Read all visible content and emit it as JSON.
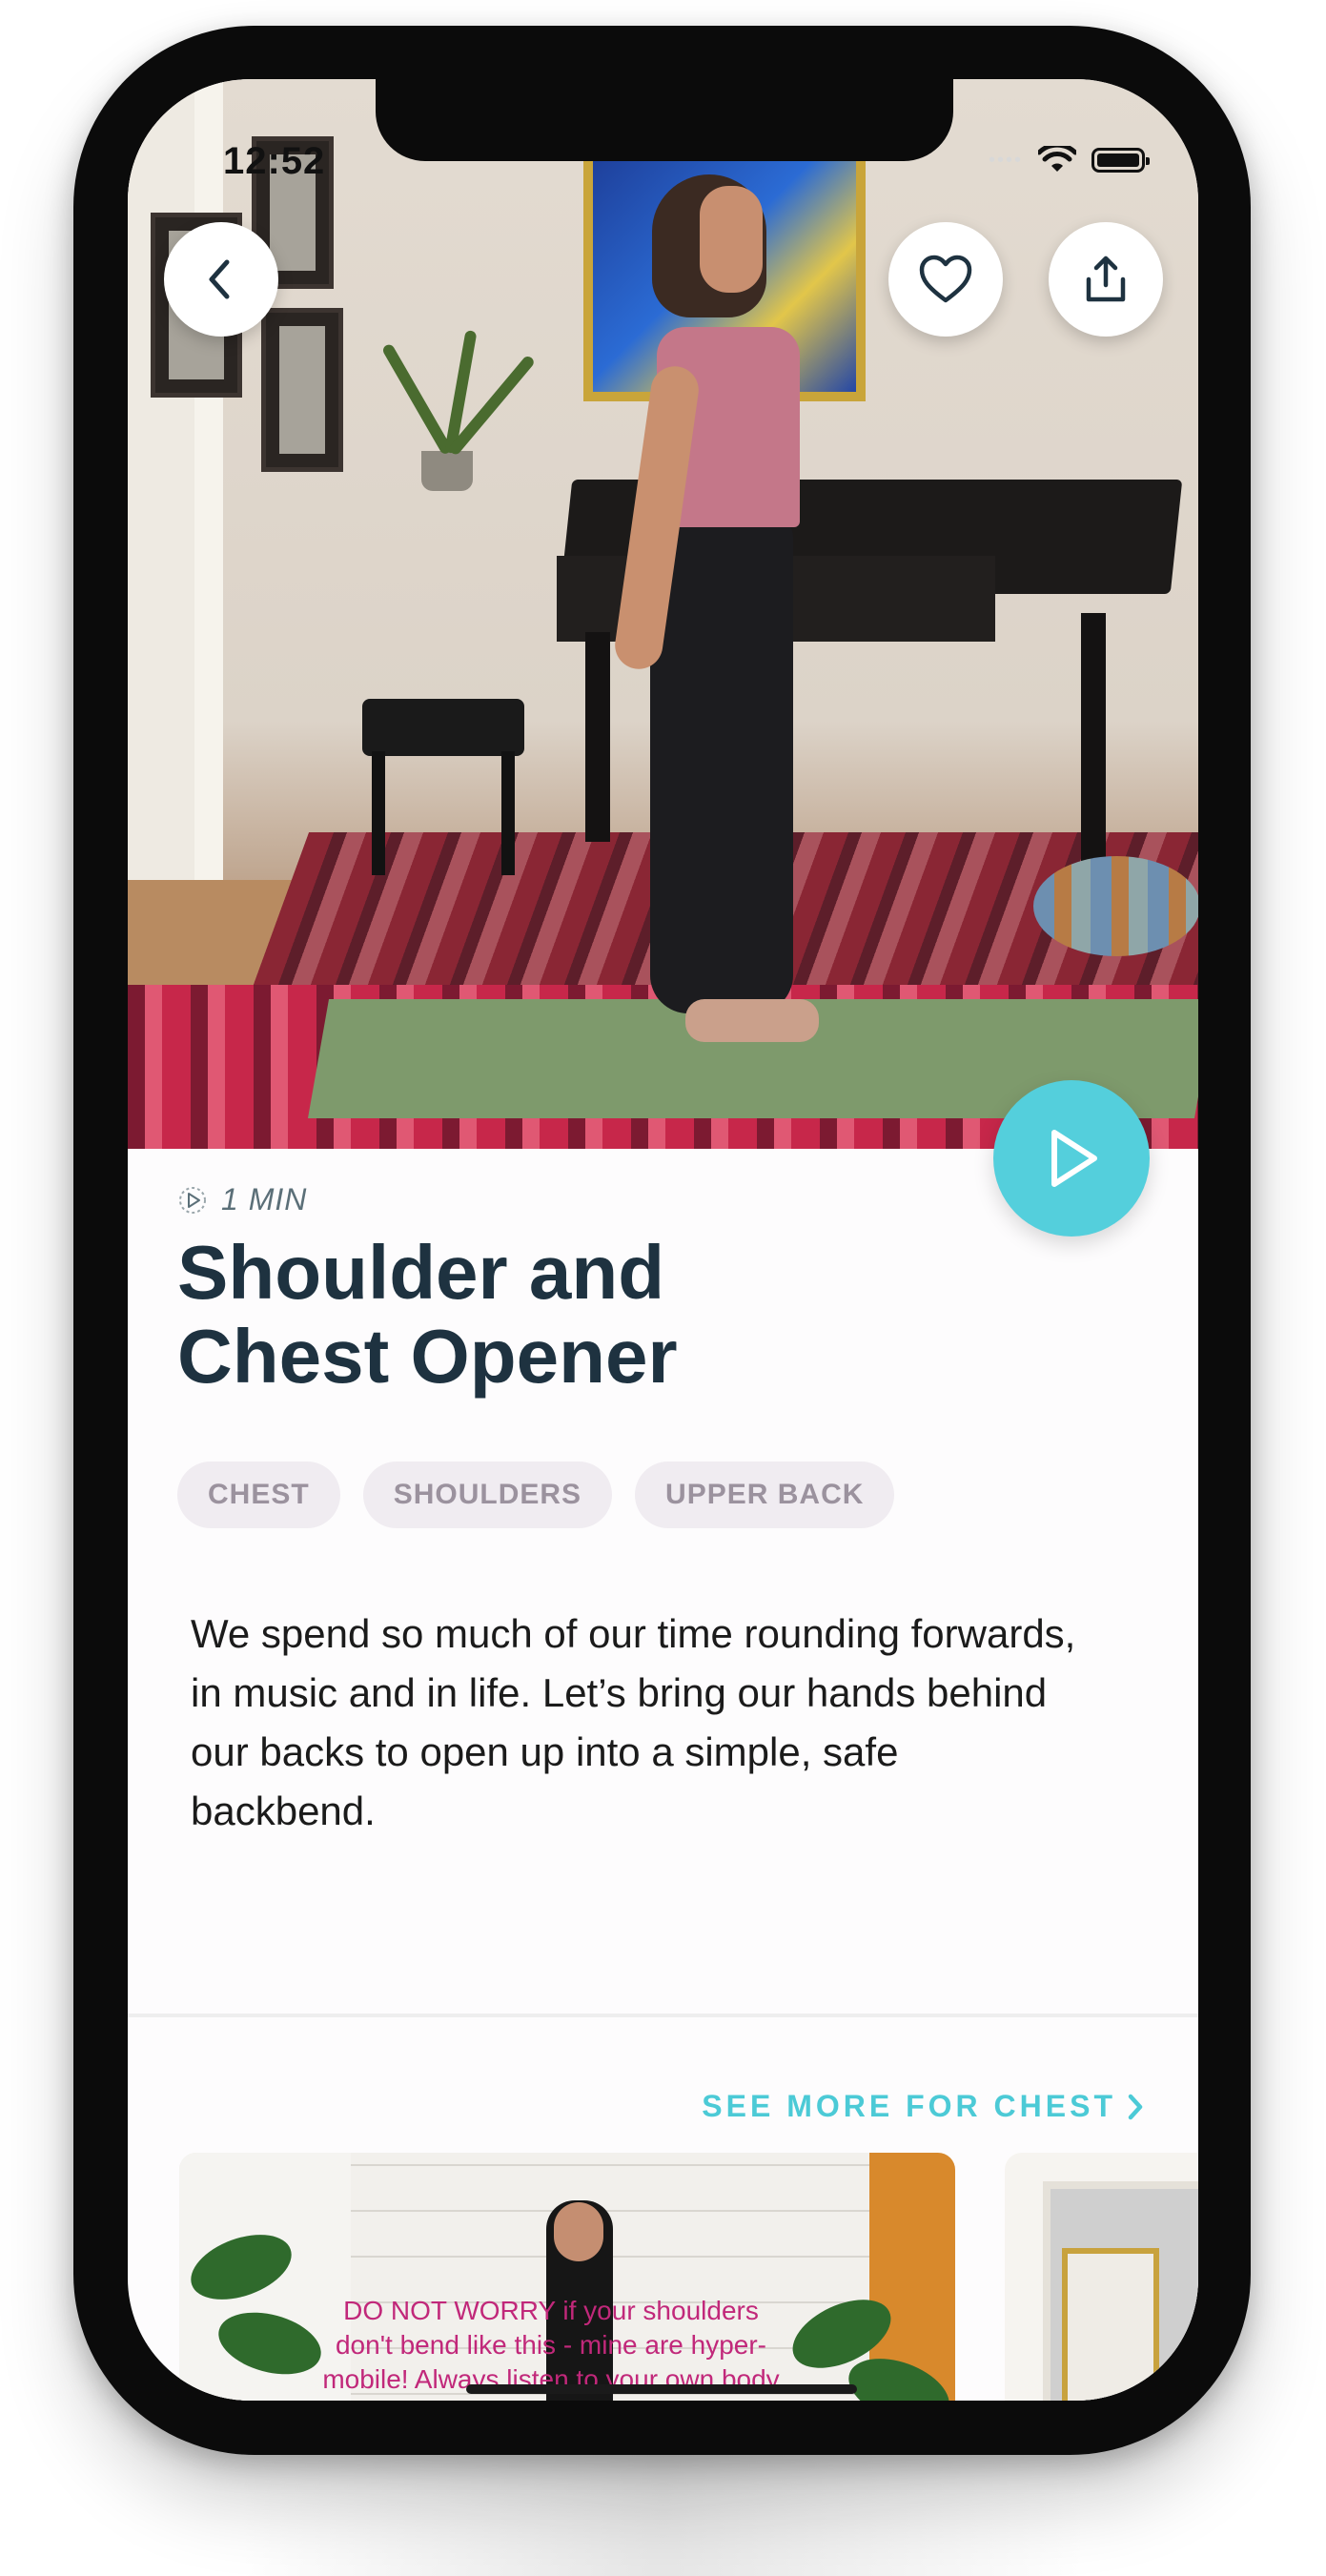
{
  "status_bar": {
    "time": "12:52"
  },
  "header_actions": {
    "back_icon": "chevron-left-icon",
    "favorite_icon": "heart-icon",
    "share_icon": "share-icon"
  },
  "video": {
    "description": "Instructor standing on yoga mat with hands clasped behind back",
    "play_icon": "play-icon"
  },
  "exercise": {
    "duration": "1 MIN",
    "title_line1": "Shoulder and",
    "title_line2": "Chest Opener",
    "tags": [
      "CHEST",
      "SHOULDERS",
      "UPPER BACK"
    ],
    "description": "We spend so much of our time rounding forwards, in music and in life. Let’s bring our hands behind our backs to open up into a simple, safe backbend."
  },
  "related": {
    "see_more_label": "SEE MORE FOR CHEST",
    "card1_caption": "DO NOT WORRY if your shoulders don't bend like this - mine are hyper-mobile! Always listen to your own body and"
  },
  "colors": {
    "accent": "#54cfdc",
    "link": "#4ccad6",
    "title": "#1e3240",
    "tag_bg": "#f0ecf1",
    "tag_text": "#9b929e",
    "caption": "#c1287a"
  }
}
